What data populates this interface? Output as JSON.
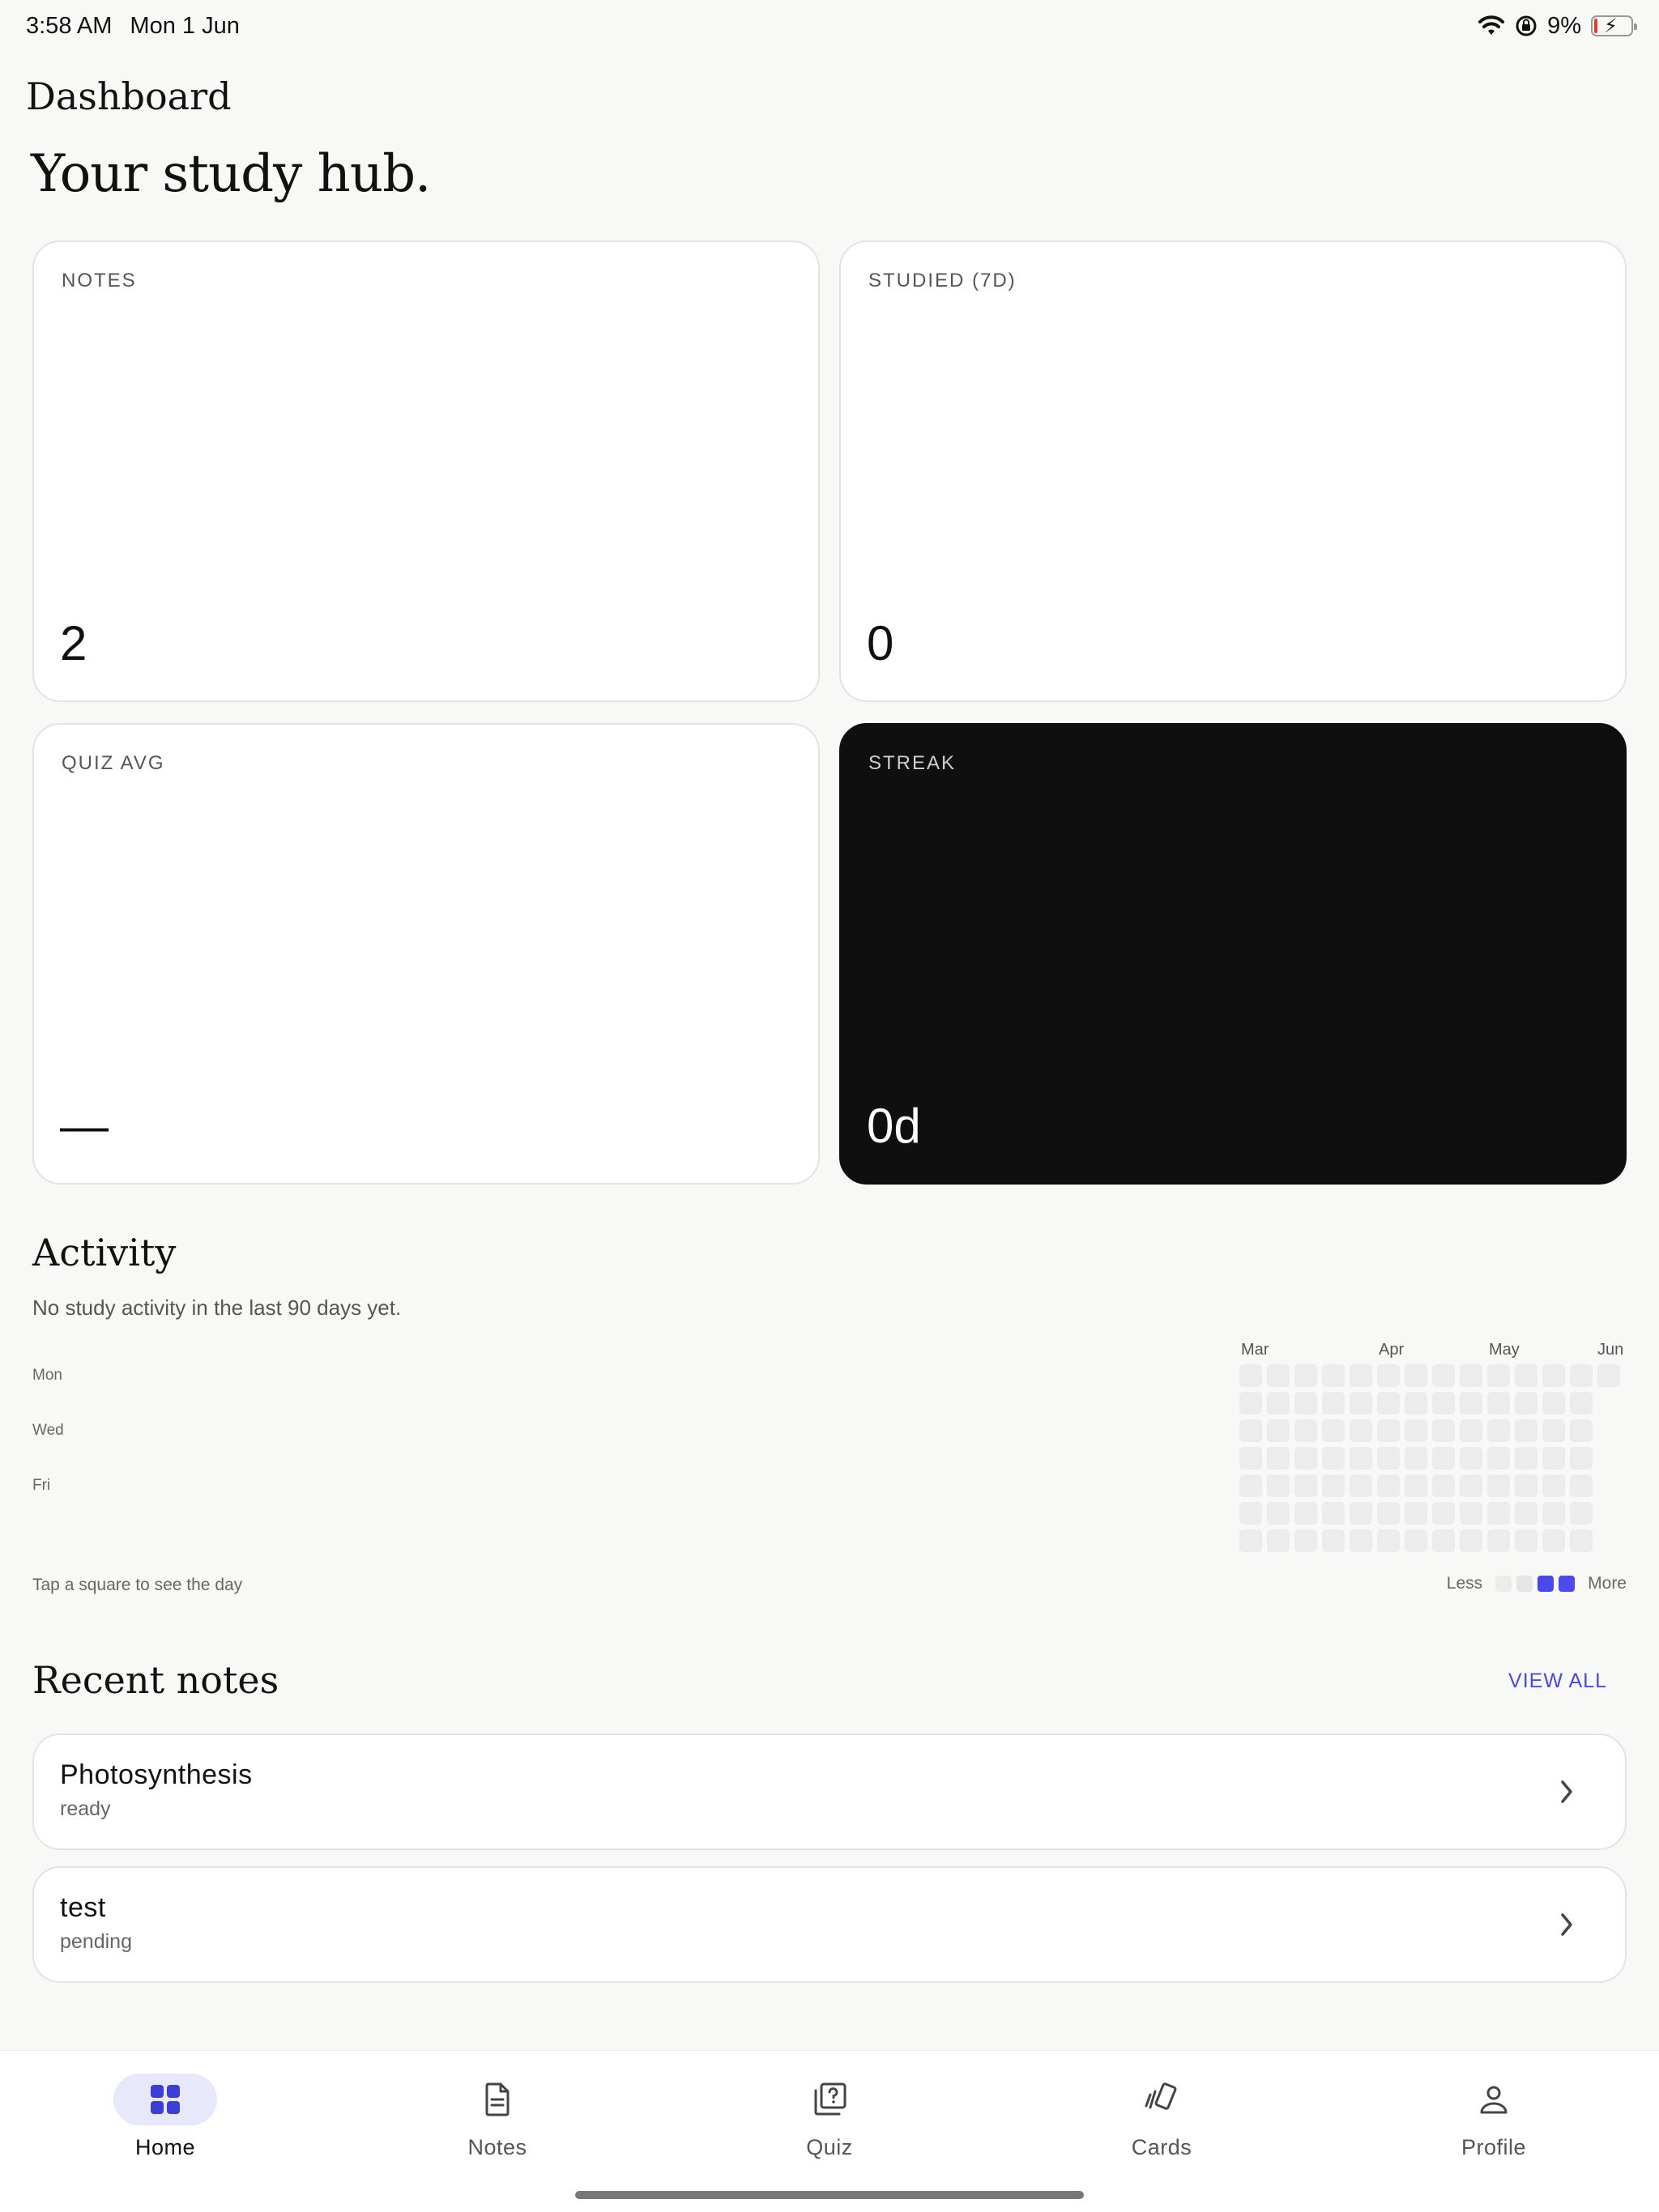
{
  "status_bar": {
    "time": "3:58 AM",
    "date": "Mon 1 Jun",
    "battery_percent": "9%",
    "battery_level": 0.09,
    "battery_color": "#e53935"
  },
  "header": {
    "nav_title": "Dashboard",
    "page_title": "Your study hub."
  },
  "stats": {
    "notes": {
      "label": "NOTES",
      "value": "2"
    },
    "studied": {
      "label": "STUDIED (7D)",
      "value": "0"
    },
    "quiz_avg": {
      "label": "QUIZ AVG",
      "value": "—"
    },
    "streak": {
      "label": "STREAK",
      "value": "0d"
    }
  },
  "activity": {
    "title": "Activity",
    "empty_text": "No study activity in the last 90 days yet.",
    "day_labels": [
      "Mon",
      "Wed",
      "Fri"
    ],
    "months": [
      "Mar",
      "Apr",
      "May",
      "Jun"
    ],
    "weeks": 14,
    "last_week_days": 1,
    "empty_cell_color": "#ececec",
    "tap_hint": "Tap a square to see the day",
    "legend": {
      "less": "Less",
      "more": "More",
      "swatches": [
        "#ececec",
        "#e6e6e6",
        "#4a4ae8",
        "#4b4bf0"
      ]
    }
  },
  "recent_notes": {
    "title": "Recent notes",
    "view_all": "VIEW ALL",
    "accent_color": "#4a4adb",
    "items": [
      {
        "title": "Photosynthesis",
        "status": "ready"
      },
      {
        "title": "test",
        "status": "pending"
      }
    ]
  },
  "tab_bar": {
    "active_color": "#3c3fd6",
    "tabs": [
      {
        "label": "Home",
        "icon": "grid-icon",
        "active": true
      },
      {
        "label": "Notes",
        "icon": "document-icon",
        "active": false
      },
      {
        "label": "Quiz",
        "icon": "quiz-icon",
        "active": false
      },
      {
        "label": "Cards",
        "icon": "cards-icon",
        "active": false
      },
      {
        "label": "Profile",
        "icon": "person-icon",
        "active": false
      }
    ]
  }
}
